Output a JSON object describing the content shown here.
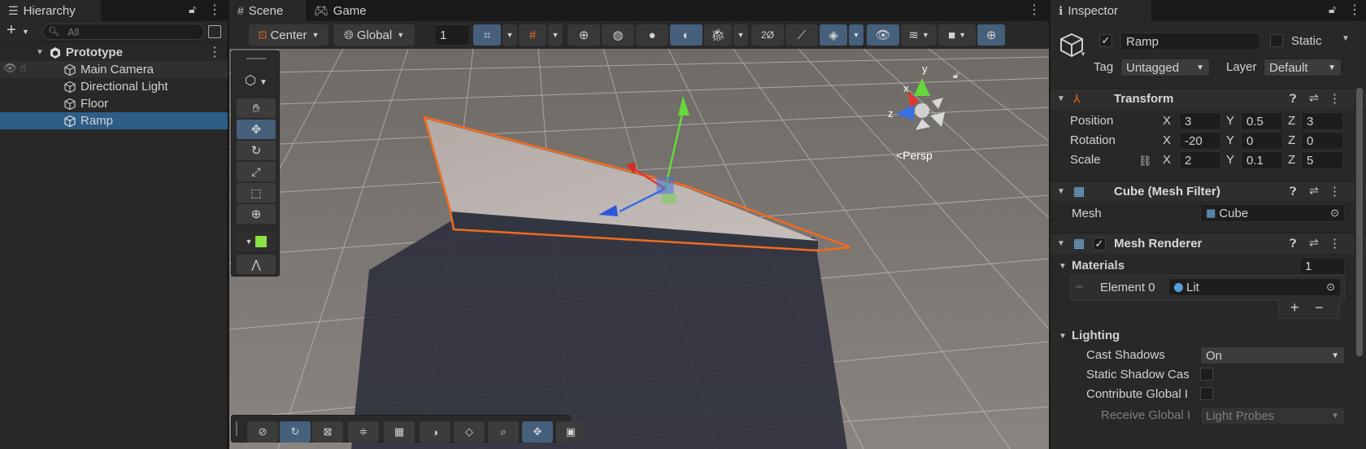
{
  "hierarchy": {
    "tab_label": "Hierarchy",
    "search_placeholder": "All",
    "scene_name": "Prototype",
    "items": [
      {
        "label": "Main Camera"
      },
      {
        "label": "Directional Light"
      },
      {
        "label": "Floor"
      },
      {
        "label": "Ramp"
      }
    ],
    "selected_item": "Ramp"
  },
  "scene_view": {
    "tabs": [
      {
        "label": "Scene"
      },
      {
        "label": "Game"
      }
    ],
    "active_tab": "Scene",
    "toolbar": {
      "pivot_label": "Center",
      "space_label": "Global",
      "grid_value": "1"
    },
    "gizmo": {
      "x_label": "x",
      "y_label": "y",
      "z_label": "z",
      "projection_label": "<Persp"
    }
  },
  "inspector": {
    "tab_label": "Inspector",
    "object_name": "Ramp",
    "active": true,
    "static_label": "Static",
    "static_checked": false,
    "tag_label": "Tag",
    "tag_value": "Untagged",
    "layer_label": "Layer",
    "layer_value": "Default",
    "transform": {
      "title": "Transform",
      "position_label": "Position",
      "rotation_label": "Rotation",
      "scale_label": "Scale",
      "axis_x": "X",
      "axis_y": "Y",
      "axis_z": "Z",
      "position": {
        "x": "3",
        "y": "0.5",
        "z": "3"
      },
      "rotation": {
        "x": "-20",
        "y": "0",
        "z": "0"
      },
      "scale": {
        "x": "2",
        "y": "0.1",
        "z": "5"
      }
    },
    "mesh_filter": {
      "title": "Cube (Mesh Filter)",
      "mesh_label": "Mesh",
      "mesh_value": "Cube"
    },
    "mesh_renderer": {
      "title": "Mesh Renderer",
      "enabled": true,
      "materials_label": "Materials",
      "materials_count": "1",
      "element_label": "Element 0",
      "element_value": "Lit",
      "lighting_label": "Lighting",
      "cast_shadows_label": "Cast Shadows",
      "cast_shadows_value": "On",
      "static_shadow_label": "Static Shadow Cas",
      "contribute_gi_label": "Contribute Global I",
      "receive_gi_label": "Receive Global I",
      "receive_gi_value": "Light Probes"
    }
  },
  "colors": {
    "accent": "#2c5d87",
    "selection_outline": "#f26b1d",
    "axis_x": "#e8332a",
    "axis_y": "#66d83c",
    "axis_z": "#3a6fe0"
  }
}
